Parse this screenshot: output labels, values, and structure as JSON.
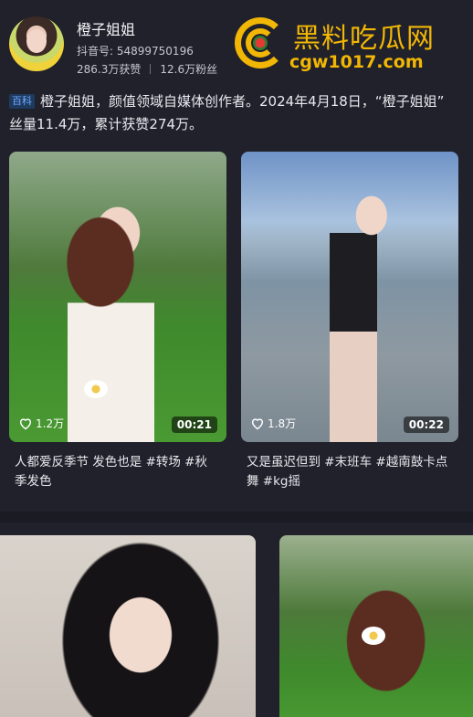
{
  "profile": {
    "name": "橙子姐姐",
    "douyin_id": "抖音号: 54899750196",
    "likes": "286.3万获赞",
    "fans": "12.6万粉丝"
  },
  "watermark": {
    "title": "黑料吃瓜网",
    "url": "cgw1017.com"
  },
  "intro": {
    "badge": "百科",
    "line1": "橙子姐姐，颜值领域自媒体创作者。2024年4月18日，“橙子姐姐”",
    "line2": "丝量11.4万，累计获赞274万。"
  },
  "videos": [
    {
      "likes": "1.2万",
      "duration": "00:21",
      "caption_line1": "人都爱反季节 发色也是 #转场 #秋",
      "caption_line2": "季发色"
    },
    {
      "likes": "1.8万",
      "duration": "00:22",
      "caption_line1": "又是虽迟但到 #末班车 #越南鼓卡点",
      "caption_line2": "舞 #kg摇"
    }
  ],
  "colors": {
    "background": "#20212b",
    "watermark": "#f2b705",
    "badge_text": "#6fa8ff"
  }
}
